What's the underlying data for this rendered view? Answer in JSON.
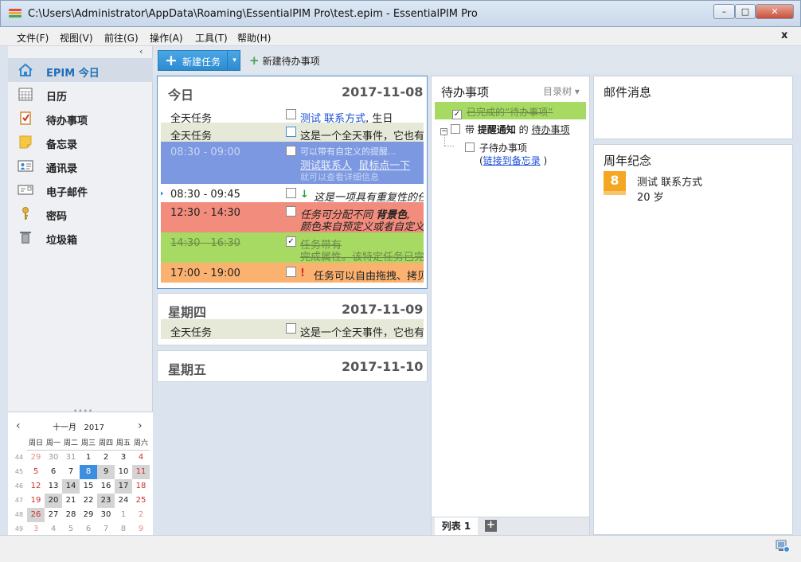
{
  "window": {
    "title": "C:\\Users\\Administrator\\AppData\\Roaming\\EssentialPIM Pro\\test.epim - EssentialPIM Pro",
    "min_glyph": "–",
    "max_glyph": "□",
    "close_glyph": "✕"
  },
  "menu": {
    "items": [
      "文件(F)",
      "视图(V)",
      "前往(G)",
      "操作(A)",
      "工具(T)",
      "帮助(H)"
    ],
    "close": "x"
  },
  "nav": {
    "collapse": "‹",
    "items": [
      {
        "label": "EPIM 今日",
        "icon": "home-icon"
      },
      {
        "label": "日历",
        "icon": "calendar-icon"
      },
      {
        "label": "待办事项",
        "icon": "clipboard-checklist-icon"
      },
      {
        "label": "备忘录",
        "icon": "sticky-note-icon"
      },
      {
        "label": "通讯录",
        "icon": "contact-card-icon"
      },
      {
        "label": "电子邮件",
        "icon": "envelope-icon"
      },
      {
        "label": "密码",
        "icon": "key-icon"
      },
      {
        "label": "垃圾箱",
        "icon": "trash-icon"
      }
    ],
    "active_index": 0
  },
  "minical": {
    "prev": "‹",
    "next": "›",
    "month": "十一月",
    "year": "2017",
    "weekdays": [
      "周日",
      "周一",
      "周二",
      "周三",
      "周四",
      "周五",
      "周六"
    ],
    "weeks": [
      {
        "wk": "44",
        "days": [
          "29",
          "30",
          "31",
          "1",
          "2",
          "3",
          "4"
        ]
      },
      {
        "wk": "45",
        "days": [
          "5",
          "6",
          "7",
          "8",
          "9",
          "10",
          "11"
        ]
      },
      {
        "wk": "46",
        "days": [
          "12",
          "13",
          "14",
          "15",
          "16",
          "17",
          "18"
        ]
      },
      {
        "wk": "47",
        "days": [
          "19",
          "20",
          "21",
          "22",
          "23",
          "24",
          "25"
        ]
      },
      {
        "wk": "48",
        "days": [
          "26",
          "27",
          "28",
          "29",
          "30",
          "1",
          "2"
        ]
      },
      {
        "wk": "49",
        "days": [
          "3",
          "4",
          "5",
          "6",
          "7",
          "8",
          "9"
        ]
      }
    ],
    "today": "8"
  },
  "toolbar": {
    "new_task": "新建任务",
    "new_todo": "新建待办事项",
    "plus": "+",
    "caret": "▾"
  },
  "today_panel": {
    "title": "今日",
    "date": "2017-11-08",
    "events": [
      {
        "time": "全天任务",
        "text_link": "测试 联系方式",
        "text_rest": ", 生日"
      },
      {
        "time": "全天任务",
        "text": "这是一个全天事件，它也有"
      },
      {
        "time": "08:30 - 09:00",
        "line1": "可以带有自定义的提醒...",
        "line2_a": "测试联系人",
        "line2_b": "鼠标点一下",
        "line3": "就可以查看详细信息"
      },
      {
        "time": "08:30 - 09:45",
        "arrow": "↓",
        "text": "这是一项具有重复性的任务"
      },
      {
        "time": "12:30 - 14:30",
        "line1_a": "任务可分配不同 ",
        "line1_b": "背景色",
        "line1_c": ",",
        "line2": "颜色来自预定义或者自定义"
      },
      {
        "time": "14:30 - 16:30",
        "line1": "任务带有",
        "line2": "完成属性。该特定任务已完成",
        "check": "✓"
      },
      {
        "time": "17:00 - 19:00",
        "excl": "!",
        "text": "任务可以自由拖拽、拷贝"
      }
    ]
  },
  "thu_panel": {
    "title": "星期四",
    "date": "2017-11-09",
    "events": [
      {
        "time": "全天任务",
        "text": "这是一个全天事件，它也有"
      }
    ]
  },
  "fri_panel": {
    "title": "星期五",
    "date": "2017-11-10"
  },
  "todo": {
    "header": "待办事项",
    "view_button": "目录树 ▾",
    "items": [
      {
        "text": "已完成的“待办事项”",
        "check": "✓"
      },
      {
        "text_a": "带 ",
        "text_b": "提醒通知",
        "text_c": " 的 ",
        "text_d": "待办事项"
      },
      {
        "text": "子待办事项"
      },
      {
        "text_a": "(",
        "link": "链接到备忘录",
        "text_b": ")"
      }
    ],
    "tab": "列表 1",
    "add_tab": "+",
    "collapse_glyph": "−"
  },
  "mail": {
    "header": "邮件消息"
  },
  "anniversary": {
    "header": "周年纪念",
    "day": "8",
    "name": "测试 联系方式",
    "age": "20 岁"
  }
}
